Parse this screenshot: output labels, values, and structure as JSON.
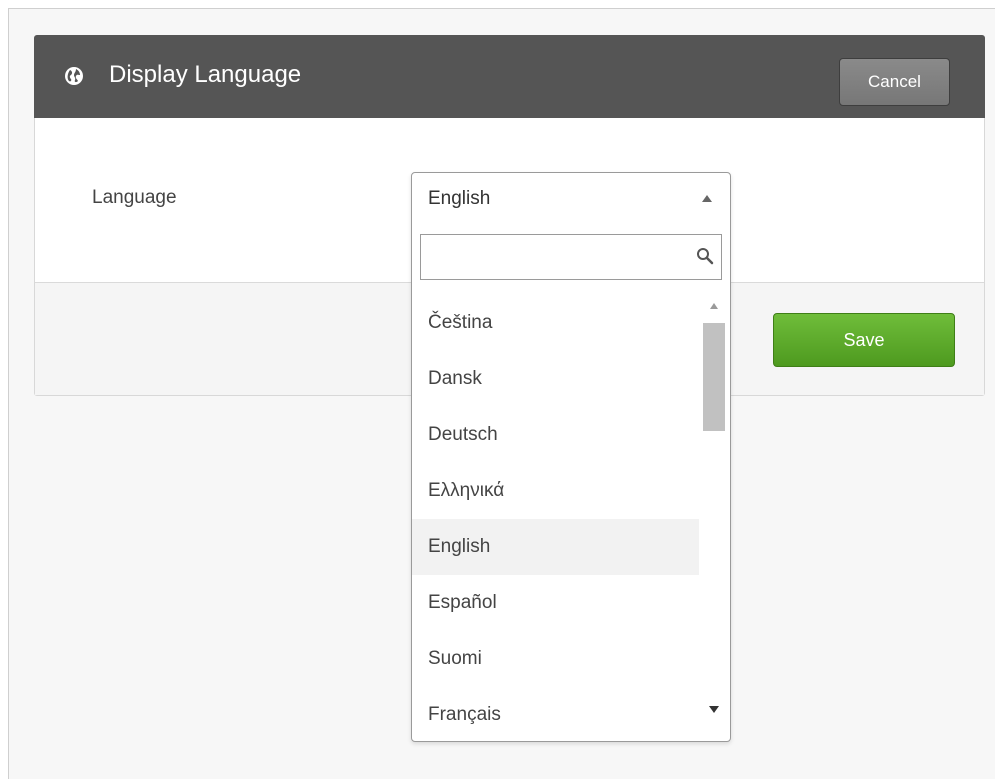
{
  "dialog": {
    "title": "Display Language",
    "cancel_label": "Cancel",
    "save_label": "Save"
  },
  "form": {
    "language_label": "Language",
    "selected_language": "English"
  },
  "dropdown": {
    "search_value": "",
    "options": [
      {
        "label": "Čeština"
      },
      {
        "label": "Dansk"
      },
      {
        "label": "Deutsch"
      },
      {
        "label": "Ελληνικά"
      },
      {
        "label": "English"
      },
      {
        "label": "Español"
      },
      {
        "label": "Suomi"
      },
      {
        "label": "Français"
      }
    ],
    "highlighted_option": "English"
  },
  "icons": {
    "title_icon": "globe-icon",
    "search_icon": "search-icon",
    "select_arrow": "chevron-up-icon",
    "scroll_up": "scroll-up-icon",
    "scroll_down": "scroll-down-icon"
  },
  "colors": {
    "header_bg": "#555555",
    "save_green": "#5aa62a",
    "cancel_gray": "#7f7f7f"
  }
}
